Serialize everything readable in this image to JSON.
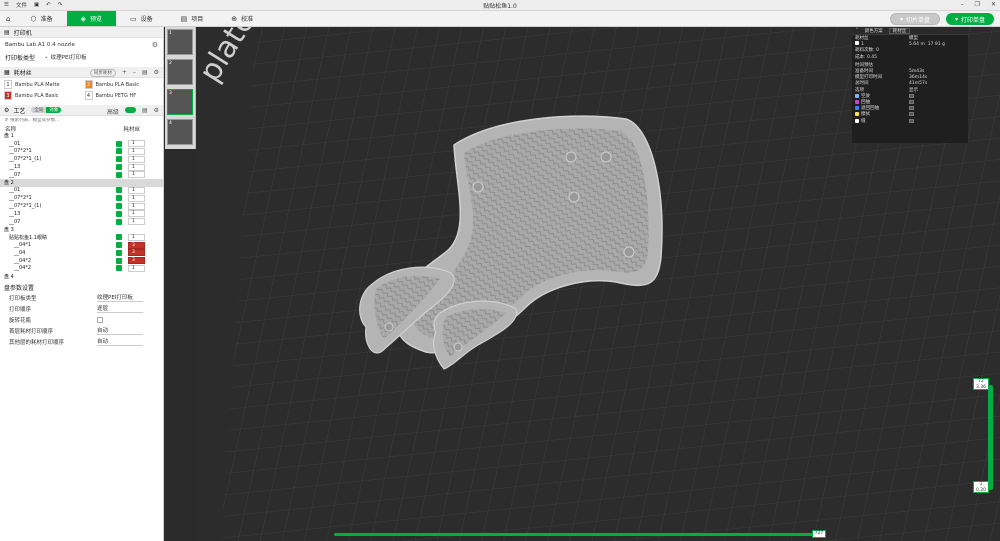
{
  "window": {
    "title": "贴贴松鱼1.0",
    "menu_file": "文件",
    "icons": [
      "menu-icon",
      "save-icon",
      "undo-icon",
      "redo-icon"
    ]
  },
  "toolbar": {
    "tabs": [
      {
        "label": "准备",
        "icon": "cube-icon"
      },
      {
        "label": "预览",
        "icon": "preview-icon",
        "active": true
      },
      {
        "label": "设备",
        "icon": "device-icon"
      },
      {
        "label": "项目",
        "icon": "project-icon"
      },
      {
        "label": "校准",
        "icon": "calibrate-icon"
      }
    ],
    "slice_label": "切片单盘",
    "print_label": "打印单盘"
  },
  "printer": {
    "section": "打印机",
    "name": "Bambu Lab A1 0.4 nozzle",
    "plate_type_label": "打印板类型",
    "plate_type_value": "纹理PEI打印板"
  },
  "filament": {
    "section": "耗材丝",
    "sync_label": "同步耗材",
    "items": [
      {
        "num": "1",
        "name": "Bambu PLA Matte",
        "color": "#ffffff"
      },
      {
        "num": "2",
        "name": "Bambu PLA Basic",
        "color": "#e8862a"
      },
      {
        "num": "3",
        "name": "Bambu PLA Basic",
        "color": "#c0332a"
      },
      {
        "num": "4",
        "name": "Bambu PETG HF",
        "color": "#ffffff"
      }
    ]
  },
  "process": {
    "section": "工艺",
    "toggle_global": "全局",
    "toggle_object": "对象",
    "advanced_label": "高级",
    "search_placeholder": "搜索列表、模型或参数...",
    "col_name": "名称",
    "col_filament": "耗材丝",
    "rows": [
      {
        "name": "盘 1",
        "level": 0,
        "type": "plate"
      },
      {
        "name": "__01",
        "level": 1,
        "ext": "1"
      },
      {
        "name": "__07*2*1",
        "level": 1,
        "ext": "1"
      },
      {
        "name": "__07*2*1_(1)",
        "level": 1,
        "ext": "1"
      },
      {
        "name": "__13",
        "level": 1,
        "ext": "1"
      },
      {
        "name": "__07",
        "level": 1,
        "ext": "1"
      },
      {
        "name": "盘 2",
        "level": 0,
        "type": "plate",
        "selected": true
      },
      {
        "name": "__01",
        "level": 1,
        "ext": "1"
      },
      {
        "name": "__07*2*1",
        "level": 1,
        "ext": "1"
      },
      {
        "name": "__07*2*1_(1)",
        "level": 1,
        "ext": "1"
      },
      {
        "name": "__13",
        "level": 1,
        "ext": "1"
      },
      {
        "name": "__07",
        "level": 1,
        "ext": "1"
      },
      {
        "name": "盘 3",
        "level": 0,
        "type": "plate"
      },
      {
        "name": "贴贴松鱼1.1眼睛",
        "level": 1,
        "ext": "1"
      },
      {
        "name": "__04*1",
        "level": 2,
        "ext": "3",
        "red": true
      },
      {
        "name": "__04",
        "level": 2,
        "ext": "3",
        "red": true
      },
      {
        "name": "__04*2",
        "level": 2,
        "ext": "3",
        "red": true
      },
      {
        "name": "__04*2",
        "level": 2,
        "ext": "1"
      },
      {
        "name": "盘 4",
        "level": 0,
        "type": "plate"
      }
    ]
  },
  "plate_settings": {
    "section": "盘参数设置",
    "rows": [
      {
        "label": "打印板类型",
        "value": "纹理PEI打印板"
      },
      {
        "label": "打印顺序",
        "value": "逐层"
      },
      {
        "label": "旋转花瓶",
        "value": ""
      },
      {
        "label": "首层耗材打印顺序",
        "value": "自动"
      },
      {
        "label": "其他层的耗材打印顺序",
        "value": "自动"
      }
    ]
  },
  "thumbnails": [
    {
      "num": "1"
    },
    {
      "num": "2"
    },
    {
      "num": "3"
    },
    {
      "num": "4"
    }
  ],
  "legend": {
    "scheme_label": "颜色方案",
    "scheme_value": "耗材丝",
    "col_filament": "耗材丝",
    "col_model": "模型",
    "filament_row": {
      "num": "1",
      "length": "5.64 m",
      "weight": "17.91 g"
    },
    "change_count": "耗料次数: 0",
    "cost": "成本: 0.45",
    "time_section": "时间预估",
    "times": [
      {
        "label": "准备时间",
        "value": "5m43s"
      },
      {
        "label": "模型打印时间",
        "value": "36m14s"
      },
      {
        "label": "总时间",
        "value": "41m57s"
      }
    ],
    "options_col": "选项",
    "display_col": "显示",
    "options": [
      {
        "label": "空驶",
        "color": "#7fb5ff"
      },
      {
        "label": "回抽",
        "color": "#d63cd6"
      },
      {
        "label": "退回回抽",
        "color": "#3c7cff"
      },
      {
        "label": "擦拭",
        "color": "#ffe14d"
      },
      {
        "label": "缝",
        "color": "#ffffff"
      }
    ]
  },
  "layer_slider": {
    "top_label": "72\n3.36",
    "bottom_label": "1\n0.20"
  },
  "move_slider": {
    "label": "727"
  },
  "bed_label": "plate"
}
